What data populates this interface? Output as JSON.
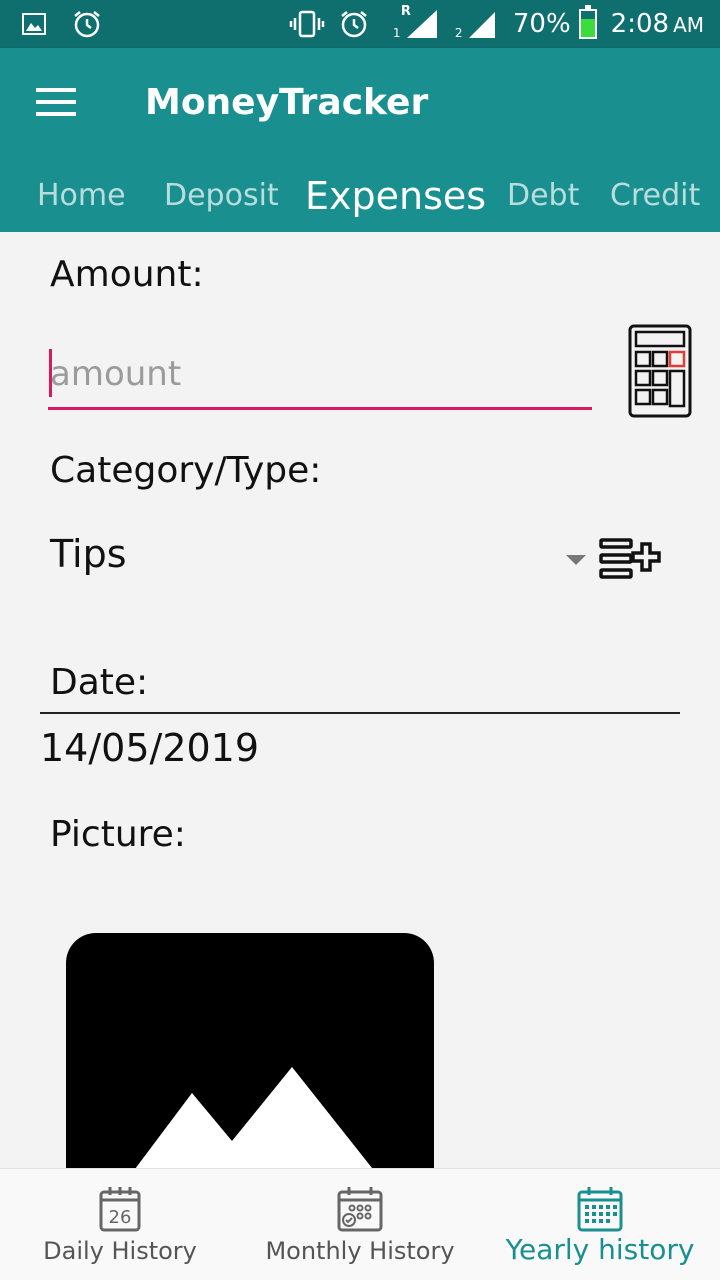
{
  "status_bar": {
    "battery_percent": "70%",
    "battery_level": 0.7,
    "battery_color": "#3ddc3d",
    "time": "2:08",
    "time_suffix": "AM",
    "sim1_label": "1",
    "sim1_roaming": "R",
    "sim2_label": "2",
    "icons": [
      "gallery-icon",
      "alarm-icon",
      "vibrate-icon",
      "alarm-icon",
      "signal-icon",
      "signal-icon",
      "battery-icon"
    ]
  },
  "app_bar": {
    "title": "MoneyTracker",
    "menu_icon": "hamburger-menu-icon",
    "color": "#198f90"
  },
  "tabs": [
    {
      "label": "Home",
      "active": false
    },
    {
      "label": "Deposit",
      "active": false
    },
    {
      "label": "Expenses",
      "active": true
    },
    {
      "label": "Debt",
      "active": false
    },
    {
      "label": "Credit",
      "active": false
    }
  ],
  "form": {
    "amount_label": "Amount:",
    "amount_placeholder": "amount",
    "amount_value": "",
    "category_label": "Category/Type:",
    "category_value": "Tips",
    "date_label": "Date:",
    "date_value": "14/05/2019",
    "picture_label": "Picture:",
    "accent_color": "#d81b60"
  },
  "bottom_nav": [
    {
      "label": "Daily History",
      "icon": "calendar-day-icon",
      "icon_text": "26",
      "active": false
    },
    {
      "label": "Monthly History",
      "icon": "calendar-month-icon",
      "active": false
    },
    {
      "label": "Yearly history",
      "icon": "calendar-year-icon",
      "active": true
    }
  ]
}
